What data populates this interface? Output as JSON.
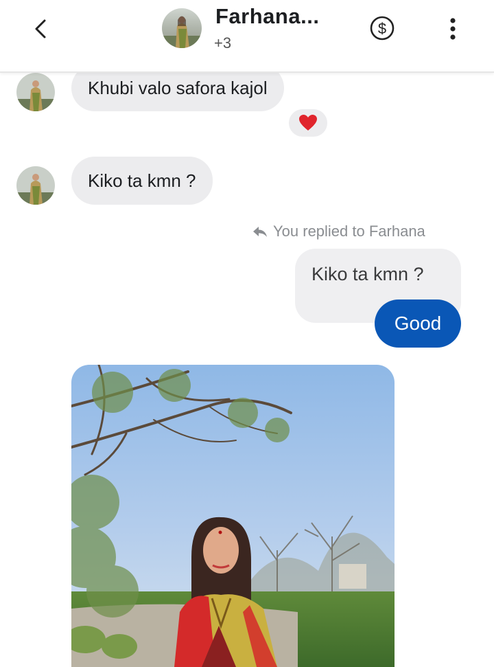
{
  "header": {
    "title": "Farhana...",
    "subtitle": "+3",
    "icons": {
      "back": "chevron-left-icon",
      "payment": "dollar-circle-icon",
      "more": "more-vertical-icon"
    }
  },
  "messages": [
    {
      "from": "Farhana",
      "text": "Khubi valo safora kajol",
      "reaction": "heart"
    },
    {
      "from": "Farhana",
      "text": "Kiko ta kmn ?"
    }
  ],
  "reply": {
    "note": "You replied to Farhana",
    "quoted_text": "Kiko ta kmn ?",
    "text": "Good"
  },
  "colors": {
    "outgoing_bubble": "#0a57b6",
    "incoming_bubble": "#ececee",
    "reaction_heart": "#e0242c"
  }
}
